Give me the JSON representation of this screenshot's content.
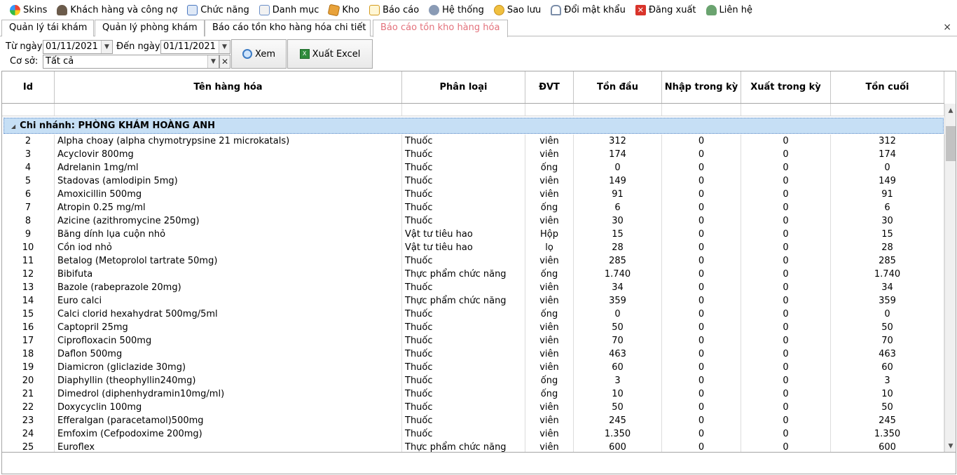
{
  "menu": [
    {
      "label": "Skins",
      "icon": "palette-icon",
      "cls": "ico-skins"
    },
    {
      "label": "Khách hàng và công nợ",
      "icon": "customer-icon",
      "cls": "ico-customer"
    },
    {
      "label": "Chức năng",
      "icon": "function-icon",
      "cls": "ico-func"
    },
    {
      "label": "Danh mục",
      "icon": "catalog-icon",
      "cls": "ico-cat"
    },
    {
      "label": "Kho",
      "icon": "warehouse-box-icon",
      "cls": "ico-stock"
    },
    {
      "label": "Báo cáo",
      "icon": "report-icon",
      "cls": "ico-report"
    },
    {
      "label": "Hệ thống",
      "icon": "system-gear-icon",
      "cls": "ico-system"
    },
    {
      "label": "Sao lưu",
      "icon": "backup-database-icon",
      "cls": "ico-backup"
    },
    {
      "label": "Đổi mật khẩu",
      "icon": "password-lock-icon",
      "cls": "ico-password"
    },
    {
      "label": "Đăng xuất",
      "icon": "logout-icon",
      "cls": "ico-logout"
    },
    {
      "label": "Liên hệ",
      "icon": "contact-person-icon",
      "cls": "ico-contact"
    }
  ],
  "tabs": [
    {
      "label": "Quản lý tái khám",
      "active": false
    },
    {
      "label": "Quản lý phòng khám",
      "active": false
    },
    {
      "label": "Báo cáo tồn kho hàng hóa chi tiết",
      "active": false
    },
    {
      "label": "Báo cáo tồn kho hàng hóa",
      "active": true
    }
  ],
  "tab_close": "×",
  "filter": {
    "from_label": "Từ ngày",
    "from_value": "01/11/2021",
    "to_label": "Đến ngày",
    "to_value": "01/11/2021",
    "branch_label": "Cơ sở:",
    "branch_value": "Tất cả",
    "view_button": "Xem",
    "excel_button": "Xuất Excel"
  },
  "grid": {
    "columns": [
      "Id",
      "Tên hàng hóa",
      "Phân loại",
      "ĐVT",
      "Tồn đầu",
      "Nhập trong kỳ",
      "Xuất trong kỳ",
      "Tồn cuối"
    ],
    "group_label": "Chi nhánh: PHÒNG KHÁM HOÀNG ANH",
    "rows": [
      [
        "2",
        "Alpha choay (alpha chymotrypsine 21 microkatals)",
        "Thuốc",
        "viên",
        "312",
        "0",
        "0",
        "312"
      ],
      [
        "3",
        "Acyclovir 800mg",
        "Thuốc",
        "viên",
        "174",
        "0",
        "0",
        "174"
      ],
      [
        "4",
        "Adrelanin 1mg/ml",
        "Thuốc",
        "ống",
        "0",
        "0",
        "0",
        "0"
      ],
      [
        "5",
        "Stadovas (amlodipin 5mg)",
        "Thuốc",
        "viên",
        "149",
        "0",
        "0",
        "149"
      ],
      [
        "6",
        "Amoxicillin 500mg",
        "Thuốc",
        "viên",
        "91",
        "0",
        "0",
        "91"
      ],
      [
        "7",
        "Atropin 0.25 mg/ml",
        "Thuốc",
        "ống",
        "6",
        "0",
        "0",
        "6"
      ],
      [
        "8",
        "Azicine (azithromycine 250mg)",
        "Thuốc",
        "viên",
        "30",
        "0",
        "0",
        "30"
      ],
      [
        "9",
        "Băng dính lụa cuộn nhỏ",
        "Vật tư tiêu hao",
        "Hộp",
        "15",
        "0",
        "0",
        "15"
      ],
      [
        "10",
        "Cồn iod nhỏ",
        "Vật tư tiêu hao",
        "lọ",
        "28",
        "0",
        "0",
        "28"
      ],
      [
        "11",
        "Betalog (Metoprolol tartrate 50mg)",
        "Thuốc",
        "viên",
        "285",
        "0",
        "0",
        "285"
      ],
      [
        "12",
        "Bibifuta",
        "Thực phẩm chức năng",
        "ống",
        "1.740",
        "0",
        "0",
        "1.740"
      ],
      [
        "13",
        "Bazole (rabeprazole 20mg)",
        "Thuốc",
        "viên",
        "34",
        "0",
        "0",
        "34"
      ],
      [
        "14",
        "Euro calci",
        "Thực phẩm chức năng",
        "viên",
        "359",
        "0",
        "0",
        "359"
      ],
      [
        "15",
        "Calci clorid hexahydrat 500mg/5ml",
        "Thuốc",
        "ống",
        "0",
        "0",
        "0",
        "0"
      ],
      [
        "16",
        "Captopril 25mg",
        "Thuốc",
        "viên",
        "50",
        "0",
        "0",
        "50"
      ],
      [
        "17",
        "Ciprofloxacin 500mg",
        "Thuốc",
        "viên",
        "70",
        "0",
        "0",
        "70"
      ],
      [
        "18",
        "Daflon 500mg",
        "Thuốc",
        "viên",
        "463",
        "0",
        "0",
        "463"
      ],
      [
        "19",
        "Diamicron (gliclazide 30mg)",
        "Thuốc",
        "viên",
        "60",
        "0",
        "0",
        "60"
      ],
      [
        "20",
        "Diaphyllin (theophyllin240mg)",
        "Thuốc",
        "ống",
        "3",
        "0",
        "0",
        "3"
      ],
      [
        "21",
        "Dimedrol (diphenhydramin10mg/ml)",
        "Thuốc",
        "ống",
        "10",
        "0",
        "0",
        "10"
      ],
      [
        "22",
        "Doxycyclin 100mg",
        "Thuốc",
        "viên",
        "50",
        "0",
        "0",
        "50"
      ],
      [
        "23",
        "Efferalgan (paracetamol)500mg",
        "Thuốc",
        "viên",
        "245",
        "0",
        "0",
        "245"
      ],
      [
        "24",
        "Emfoxim (Cefpodoxime 200mg)",
        "Thuốc",
        "viên",
        "1.350",
        "0",
        "0",
        "1.350"
      ],
      [
        "25",
        "Euroflex",
        "Thực phẩm chức năng",
        "viên",
        "600",
        "0",
        "0",
        "600"
      ]
    ]
  },
  "colors": {
    "active_tab": "#e3727c",
    "group_bar": "#c6dff5"
  }
}
